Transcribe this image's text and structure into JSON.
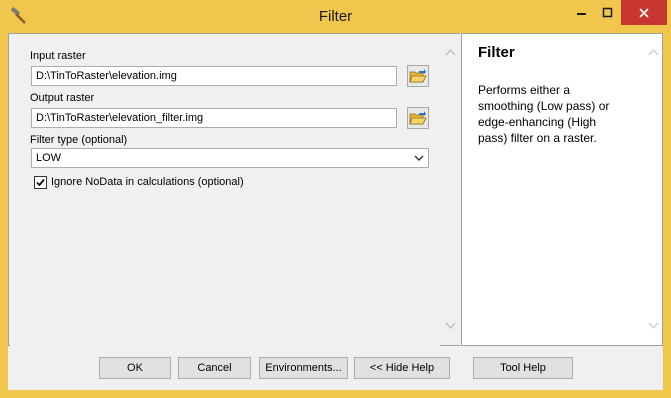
{
  "window": {
    "title": "Filter",
    "title_icon": "hammer-icon"
  },
  "form": {
    "input_raster": {
      "label": "Input raster",
      "value": "D:\\TinToRaster\\elevation.img"
    },
    "output_raster": {
      "label": "Output raster",
      "value": "D:\\TinToRaster\\elevation_filter.img"
    },
    "filter_type": {
      "label": "Filter type (optional)",
      "selected": "LOW"
    },
    "ignore_nodata": {
      "label": "Ignore NoData in calculations (optional)",
      "checked": true
    }
  },
  "help": {
    "title": "Filter",
    "text": "Performs either a smoothing (Low pass) or edge-enhancing (High pass) filter on a raster."
  },
  "buttons": {
    "ok": "OK",
    "cancel": "Cancel",
    "environments": "Environments...",
    "hide_help": "<< Hide Help",
    "tool_help": "Tool Help"
  },
  "colors": {
    "frame": "#f0c64c",
    "close": "#c7372f",
    "panel": "#f0f0f0"
  }
}
